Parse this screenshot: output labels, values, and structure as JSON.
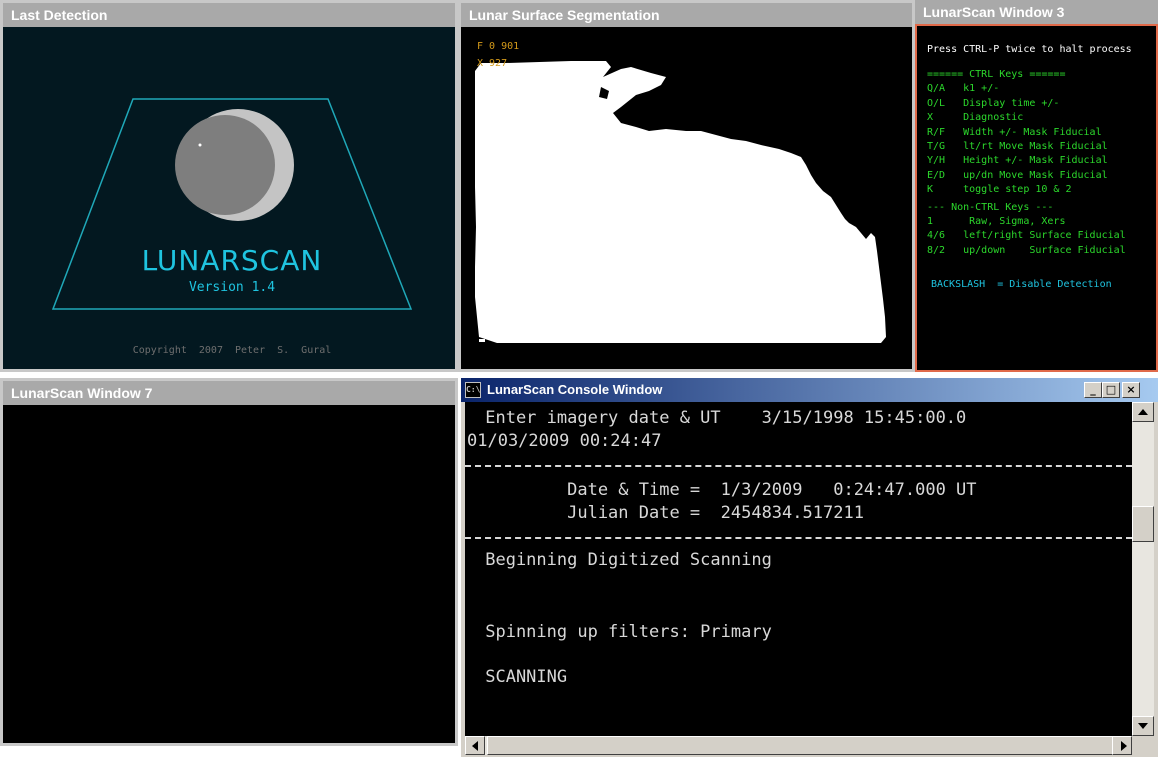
{
  "windows": {
    "last_detection": {
      "title": "Last Detection",
      "logo_title": "LUNARSCAN",
      "version": "Version  1.4",
      "copyright": "Copyright 2007   Peter S. Gural"
    },
    "segmentation": {
      "title": "Lunar Surface Segmentation",
      "label_f": "F  0  901",
      "label_x": "X  927"
    },
    "window3": {
      "title": "LunarScan Window 3",
      "header": "Press CTRL-P twice to halt process",
      "help_lines": [
        "====== CTRL Keys ======",
        "Q/A   k1 +/-",
        "O/L   Display time +/-",
        "X     Diagnostic",
        "R/F   Width +/- Mask Fiducial",
        "T/G   lt/rt Move Mask Fiducial",
        "Y/H   Height +/- Mask Fiducial",
        "E/D   up/dn Move Mask Fiducial",
        "K     toggle step 10 & 2",
        "--- Non-CTRL Keys ---",
        "1      Raw, Sigma, Xers",
        "4/6   left/right Surface Fiducial",
        "8/2   up/down    Surface Fiducial"
      ],
      "backslash_line": "BACKSLASH  = Disable Detection"
    },
    "window7": {
      "title": "LunarScan Window 7"
    },
    "console": {
      "title": "LunarScan Console Window",
      "icon_text": "C:\\",
      "minimize": "_",
      "maximize": "□",
      "close": "×",
      "lines": {
        "prompt": " Enter imagery date & UT    3/15/1998 15:45:00.0",
        "input": "01/03/2009 00:24:47",
        "datetime": "         Date & Time =  1/3/2009   0:24:47.000 UT",
        "julian": "         Julian Date =  2454834.517211",
        "beginning": " Beginning Digitized Scanning",
        "spinning": " Spinning up filters: Primary",
        "scanning": " SCANNING"
      }
    }
  },
  "colors": {
    "title_bar": "#a9a9a9",
    "logo_cyan": "#1fc4e0",
    "help_green": "#2cd82c",
    "label_orange": "#d49a1a",
    "console_text": "#d8d8d8"
  }
}
